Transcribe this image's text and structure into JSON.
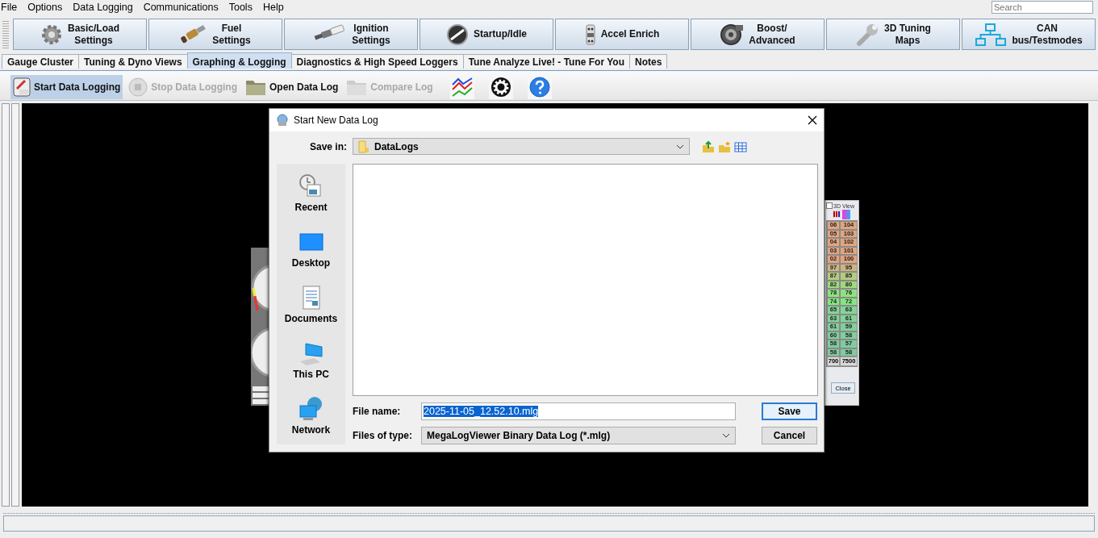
{
  "menu": [
    {
      "label": "File"
    },
    {
      "label": "Options"
    },
    {
      "label": "Data Logging"
    },
    {
      "label": "Communications"
    },
    {
      "label": "Tools"
    },
    {
      "label": "Help"
    }
  ],
  "search": {
    "placeholder": "Search"
  },
  "main_buttons": [
    {
      "lines": [
        "Basic/Load",
        "Settings"
      ]
    },
    {
      "lines": [
        "Fuel",
        "Settings"
      ]
    },
    {
      "lines": [
        "Ignition",
        "Settings"
      ]
    },
    {
      "lines": [
        "Startup/Idle"
      ]
    },
    {
      "lines": [
        "Accel Enrich"
      ]
    },
    {
      "lines": [
        "Boost/",
        "Advanced"
      ]
    },
    {
      "lines": [
        "3D Tuning",
        "Maps"
      ]
    },
    {
      "lines": [
        "CAN",
        "bus/Testmodes"
      ]
    }
  ],
  "tabs": [
    {
      "label": "Gauge Cluster",
      "selected": false
    },
    {
      "label": "Tuning & Dyno Views",
      "selected": false
    },
    {
      "label": "Graphing & Logging",
      "selected": true
    },
    {
      "label": "Diagnostics & High Speed Loggers",
      "selected": false
    },
    {
      "label": "Tune Analyze Live! - Tune For You",
      "selected": false
    },
    {
      "label": "Notes",
      "selected": false
    }
  ],
  "toolbar": [
    {
      "kind": "text",
      "label": "Start Data Logging",
      "selected": true,
      "disabled": false
    },
    {
      "kind": "text",
      "label": "Stop Data Logging",
      "selected": false,
      "disabled": true
    },
    {
      "kind": "text",
      "label": "Open Data Log",
      "selected": false,
      "disabled": false
    },
    {
      "kind": "text",
      "label": "Compare Log",
      "selected": false,
      "disabled": true
    },
    {
      "kind": "icon"
    },
    {
      "kind": "icon"
    },
    {
      "kind": "icon"
    }
  ],
  "table_window": {
    "view_label": "3D View",
    "view_checked": false,
    "rows": [
      {
        "cells": [
          "06",
          "104"
        ],
        "color": "#e3a47e"
      },
      {
        "cells": [
          "05",
          "103"
        ],
        "color": "#e3a47e"
      },
      {
        "cells": [
          "04",
          "102"
        ],
        "color": "#e3a47e"
      },
      {
        "cells": [
          "03",
          "101"
        ],
        "color": "#e3a47e"
      },
      {
        "cells": [
          "02",
          "100"
        ],
        "color": "#e3a47e"
      },
      {
        "cells": [
          "97",
          "95"
        ],
        "color": "#cdb57f"
      },
      {
        "cells": [
          "87",
          "85"
        ],
        "color": "#b5cb7e"
      },
      {
        "cells": [
          "82",
          "80"
        ],
        "color": "#9fd97e"
      },
      {
        "cells": [
          "78",
          "76"
        ],
        "color": "#8ee27e"
      },
      {
        "cells": [
          "74",
          "72"
        ],
        "color": "#84e67e"
      },
      {
        "cells": [
          "65",
          "63"
        ],
        "color": "#82d596"
      },
      {
        "cells": [
          "63",
          "61"
        ],
        "color": "#82d596"
      },
      {
        "cells": [
          "61",
          "59"
        ],
        "color": "#80cf9c"
      },
      {
        "cells": [
          "60",
          "58"
        ],
        "color": "#80cf9c"
      },
      {
        "cells": [
          "58",
          "57"
        ],
        "color": "#80cc9f"
      },
      {
        "cells": [
          "58",
          "58"
        ],
        "color": "#80cc9f"
      }
    ],
    "footer": [
      "700",
      "7500"
    ],
    "close": "Close"
  },
  "dialog": {
    "title": "Start New Data Log",
    "save_in": {
      "label": "Save in:",
      "value": "DataLogs"
    },
    "places": [
      {
        "label": "Recent"
      },
      {
        "label": "Desktop"
      },
      {
        "label": "Documents"
      },
      {
        "label": "This PC"
      },
      {
        "label": "Network"
      }
    ],
    "file_name": {
      "label": "File name:",
      "value": "2025-11-05_12.52.10.mlg",
      "selected": true
    },
    "file_type": {
      "label": "Files of type:",
      "value": "MegaLogViewer Binary Data Log (*.mlg)"
    },
    "buttons": [
      {
        "label": "Save",
        "default": true
      },
      {
        "label": "Cancel",
        "default": false
      }
    ]
  }
}
